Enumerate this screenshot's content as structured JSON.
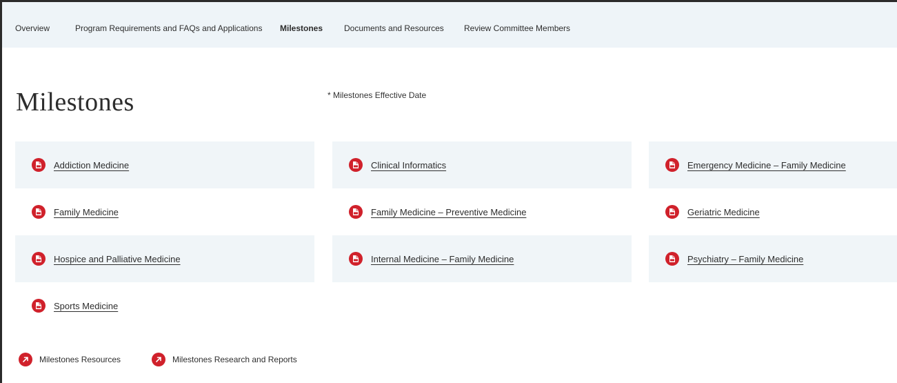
{
  "nav": {
    "tabs": [
      {
        "label": "Overview"
      },
      {
        "label": "Program Requirements and FAQs and Applications"
      },
      {
        "label": "Milestones"
      },
      {
        "label": "Documents and Resources"
      },
      {
        "label": "Review Committee Members"
      }
    ],
    "active": "Milestones"
  },
  "page": {
    "title": "Milestones",
    "effective_date_link": "* Milestones Effective Date"
  },
  "documents": [
    {
      "label": "Addiction Medicine",
      "icon": "pdf-icon"
    },
    {
      "label": "Clinical Informatics",
      "icon": "pdf-icon"
    },
    {
      "label": "Emergency Medicine – Family Medicine",
      "icon": "pdf-icon"
    },
    {
      "label": "Family Medicine",
      "icon": "pdf-icon"
    },
    {
      "label": "Family Medicine – Preventive Medicine",
      "icon": "pdf-icon"
    },
    {
      "label": "Geriatric Medicine",
      "icon": "pdf-icon"
    },
    {
      "label": "Hospice and Palliative Medicine",
      "icon": "pdf-icon"
    },
    {
      "label": "Internal Medicine – Family Medicine",
      "icon": "pdf-icon"
    },
    {
      "label": "Psychiatry – Family Medicine",
      "icon": "pdf-icon"
    },
    {
      "label": "Sports Medicine",
      "icon": "pdf-icon"
    }
  ],
  "resources": [
    {
      "label": "Milestones Resources",
      "icon": "external-arrow-icon"
    },
    {
      "label": "Milestones Research and Reports",
      "icon": "external-arrow-icon"
    }
  ],
  "colors": {
    "accent": "#d0212b",
    "nav_bg": "#eef4f8",
    "card_bg": "#f0f5f8"
  }
}
